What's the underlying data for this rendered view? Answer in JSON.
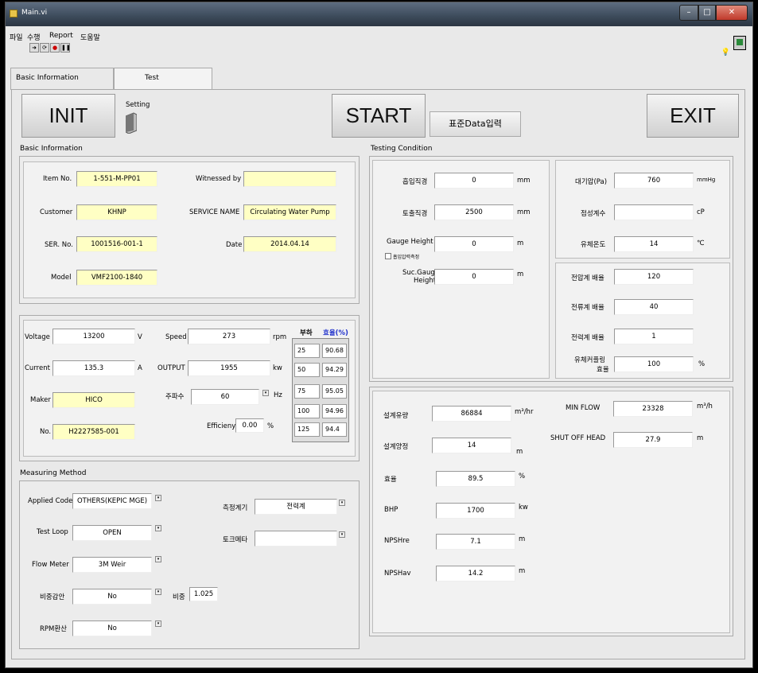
{
  "window": {
    "title": "Main.vi"
  },
  "menu": [
    "파일",
    "수행",
    "Report",
    "도움말"
  ],
  "toolbar": {
    "icons": [
      "run-arrow-icon",
      "continuous-run-icon",
      "abort-icon",
      "pause-icon"
    ],
    "glyphs": [
      "➜",
      "⟳",
      "●",
      "❚❚"
    ]
  },
  "tabs": [
    {
      "label": "Basic Information"
    },
    {
      "label": "Test"
    }
  ],
  "buttons": {
    "init": "INIT",
    "setting": "Setting",
    "start": "START",
    "std_input": "표준Data입력",
    "exit": "EXIT"
  },
  "basic_info": {
    "title": "Basic Information",
    "item_no": {
      "label": "Item No.",
      "value": "1-551-M-PP01"
    },
    "customer": {
      "label": "Customer",
      "value": "KHNP"
    },
    "ser_no": {
      "label": "SER. No.",
      "value": "1001516-001-1"
    },
    "model": {
      "label": "Model",
      "value": "VMF2100-1840"
    },
    "witnessed_by": {
      "label": "Witnessed by",
      "value": ""
    },
    "service_name": {
      "label": "SERVICE NAME",
      "value": "Circulating Water Pump"
    },
    "date": {
      "label": "Date",
      "value": "2014.04.14"
    }
  },
  "motor": {
    "voltage": {
      "label": "Voltage",
      "value": "13200",
      "unit": "V"
    },
    "current": {
      "label": "Current",
      "value": "135.3",
      "unit": "A"
    },
    "maker": {
      "label": "Maker",
      "value": "HICO"
    },
    "no": {
      "label": "No.",
      "value": "H2227585-001"
    },
    "speed": {
      "label": "Speed",
      "value": "273",
      "unit": "rpm"
    },
    "output": {
      "label": "OUTPUT",
      "value": "1955",
      "unit": "kw"
    },
    "freq": {
      "label": "주파수",
      "value": "60",
      "unit": "Hz"
    },
    "efficiency": {
      "label": "Efficieny",
      "value": "0.00",
      "unit": "%"
    },
    "load_header": "부하",
    "eff_header": "효율(%)",
    "load_table": [
      [
        "25",
        "90.68"
      ],
      [
        "50",
        "94.29"
      ],
      [
        "75",
        "95.05"
      ],
      [
        "100",
        "94.96"
      ],
      [
        "125",
        "94.4"
      ]
    ]
  },
  "measuring": {
    "title": "Measuring Method",
    "applied_code": {
      "label": "Applied Code",
      "value": "OTHERS(KEPIC MGE)"
    },
    "test_loop": {
      "label": "Test Loop",
      "value": "OPEN"
    },
    "flow_meter": {
      "label": "Flow Meter",
      "value": "3M Weir"
    },
    "sg_correction": {
      "label": "비중감안",
      "value": "No"
    },
    "rpm_conv": {
      "label": "RPM환산",
      "value": "No"
    },
    "sg": {
      "label": "비중",
      "value": "1.025"
    },
    "instrument": {
      "label": "측정계기",
      "value": "전력계"
    },
    "torque_meter": {
      "label": "토크메타",
      "value": ""
    }
  },
  "testing": {
    "title": "Testing Condition",
    "suction_dia": {
      "label": "흡입직경",
      "value": "0",
      "unit": "mm"
    },
    "discharge_dia": {
      "label": "토출직경",
      "value": "2500",
      "unit": "mm"
    },
    "gauge_height": {
      "label": "Gauge Height",
      "value": "0",
      "unit": "m"
    },
    "suction_check_label": "흡입압력측정",
    "suc_gauge_height": {
      "label1": "Suc.Gauge",
      "label2": "Height",
      "value": "0",
      "unit": "m"
    },
    "atm_pressure": {
      "label": "대기압(Pa)",
      "value": "760",
      "unit": "mmHg"
    },
    "viscosity": {
      "label": "점성계수",
      "value": "",
      "unit": "cP"
    },
    "fluid_temp": {
      "label": "유체온도",
      "value": "14",
      "unit": "℃"
    },
    "volt_mult": {
      "label": "전압계 배율",
      "value": "120"
    },
    "curr_mult": {
      "label": "전류계 배율",
      "value": "40"
    },
    "power_mult": {
      "label": "전력계 배율",
      "value": "1"
    },
    "coupling_eff": {
      "label1": "유체커플링",
      "label2": "효율",
      "value": "100",
      "unit": "%"
    }
  },
  "design": {
    "flow": {
      "label": "설계유량",
      "value": "86884",
      "unit": "m³/hr"
    },
    "head": {
      "label": "설계양정",
      "value": "14",
      "unit": "m"
    },
    "eff": {
      "label": "효율",
      "value": "89.5",
      "unit": "%"
    },
    "bhp": {
      "label": "BHP",
      "value": "1700",
      "unit": "kw"
    },
    "npshre": {
      "label": "NPSHre",
      "value": "7.1",
      "unit": "m"
    },
    "npshav": {
      "label": "NPSHav",
      "value": "14.2",
      "unit": "m"
    },
    "min_flow": {
      "label": "MIN FLOW",
      "value": "23328",
      "unit": "m³/h"
    },
    "shutoff_head": {
      "label": "SHUT OFF HEAD",
      "value": "27.9",
      "unit": "m"
    }
  }
}
